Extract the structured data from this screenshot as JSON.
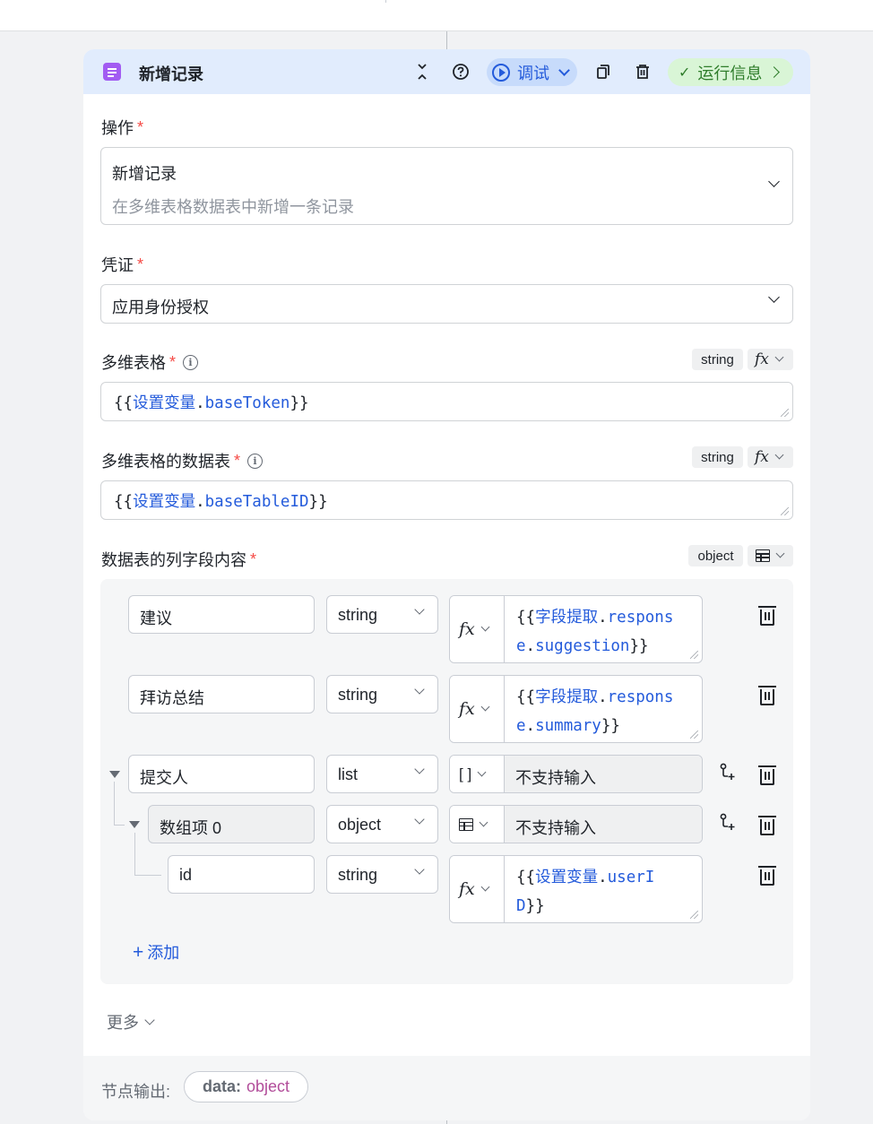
{
  "node": {
    "title": "新增记录",
    "debug_label": "调试",
    "run_info_label": "运行信息",
    "run_info_check": "✓"
  },
  "operation": {
    "label": "操作",
    "required": "*",
    "value_title": "新增记录",
    "value_desc": "在多维表格数据表中新增一条记录"
  },
  "credential": {
    "label": "凭证",
    "required": "*",
    "value": "应用身份授权"
  },
  "base": {
    "label": "多维表格",
    "required": "*",
    "type_tag": "string",
    "fx": "fx",
    "value_prefix": "{{",
    "value_var": "设置变量",
    "value_dot": ".",
    "value_field": "baseToken",
    "value_suffix": "}}"
  },
  "table": {
    "label": "多维表格的数据表",
    "required": "*",
    "type_tag": "string",
    "fx": "fx",
    "value_prefix": "{{",
    "value_var": "设置变量",
    "value_dot": ".",
    "value_field": "baseTableID",
    "value_suffix": "}}"
  },
  "fields": {
    "label": "数据表的列字段内容",
    "required": "*",
    "type_tag": "object",
    "add_label": "添加",
    "rows": [
      {
        "name": "建议",
        "type": "string",
        "fx": "fx",
        "val_prefix": "{{",
        "val_var": "字段提取",
        "val_dot": ".",
        "val_a": "respons",
        "val_b": "e",
        "val_dot2": ".",
        "val_c": "suggestion",
        "val_suffix": "}}"
      },
      {
        "name": "拜访总结",
        "type": "string",
        "fx": "fx",
        "val_prefix": "{{",
        "val_var": "字段提取",
        "val_dot": ".",
        "val_a": "respons",
        "val_b": "e",
        "val_dot2": ".",
        "val_c": "summary",
        "val_suffix": "}}"
      },
      {
        "name": "提交人",
        "type": "list",
        "sel": "[ ]",
        "value": "不支持输入"
      },
      {
        "name": "数组项 0",
        "type": "object",
        "value": "不支持输入"
      },
      {
        "name": "id",
        "type": "string",
        "fx": "fx",
        "val_prefix": "{{",
        "val_var": "设置变量",
        "val_dot": ".",
        "val_a": "userI",
        "val_b": "D",
        "val_suffix": "}}"
      }
    ]
  },
  "more_label": "更多",
  "output": {
    "label": "节点输出:",
    "key": "data:",
    "value": "object"
  }
}
